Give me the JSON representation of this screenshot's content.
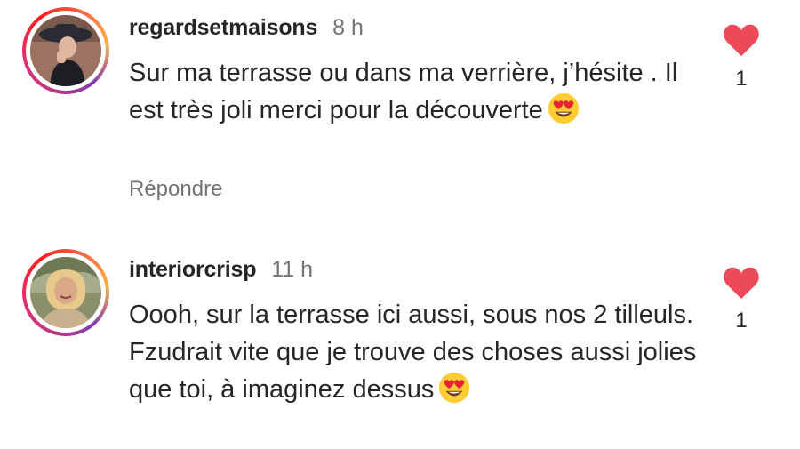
{
  "comments": [
    {
      "username": "regardsetmaisons",
      "time": "8 h",
      "text": "Sur ma terrasse ou dans ma verrière, j’hésite . Il est très joli merci pour la découverte",
      "emoji": "heart-eyes-emoji",
      "reply_label": "Répondre",
      "like_count": "1",
      "like_icon": "heart-icon"
    },
    {
      "username": "interiorcrisp",
      "time": "11 h",
      "text": "Oooh, sur la terrasse ici aussi, sous nos 2 tilleuls. Fzudrait vite que je trouve des choses aussi jolies que toi, à imaginez dessus",
      "emoji": "heart-eyes-emoji",
      "like_count": "1",
      "like_icon": "heart-icon"
    }
  ],
  "colors": {
    "like_red": "#ed4956",
    "muted": "#737373",
    "text": "#262626"
  }
}
